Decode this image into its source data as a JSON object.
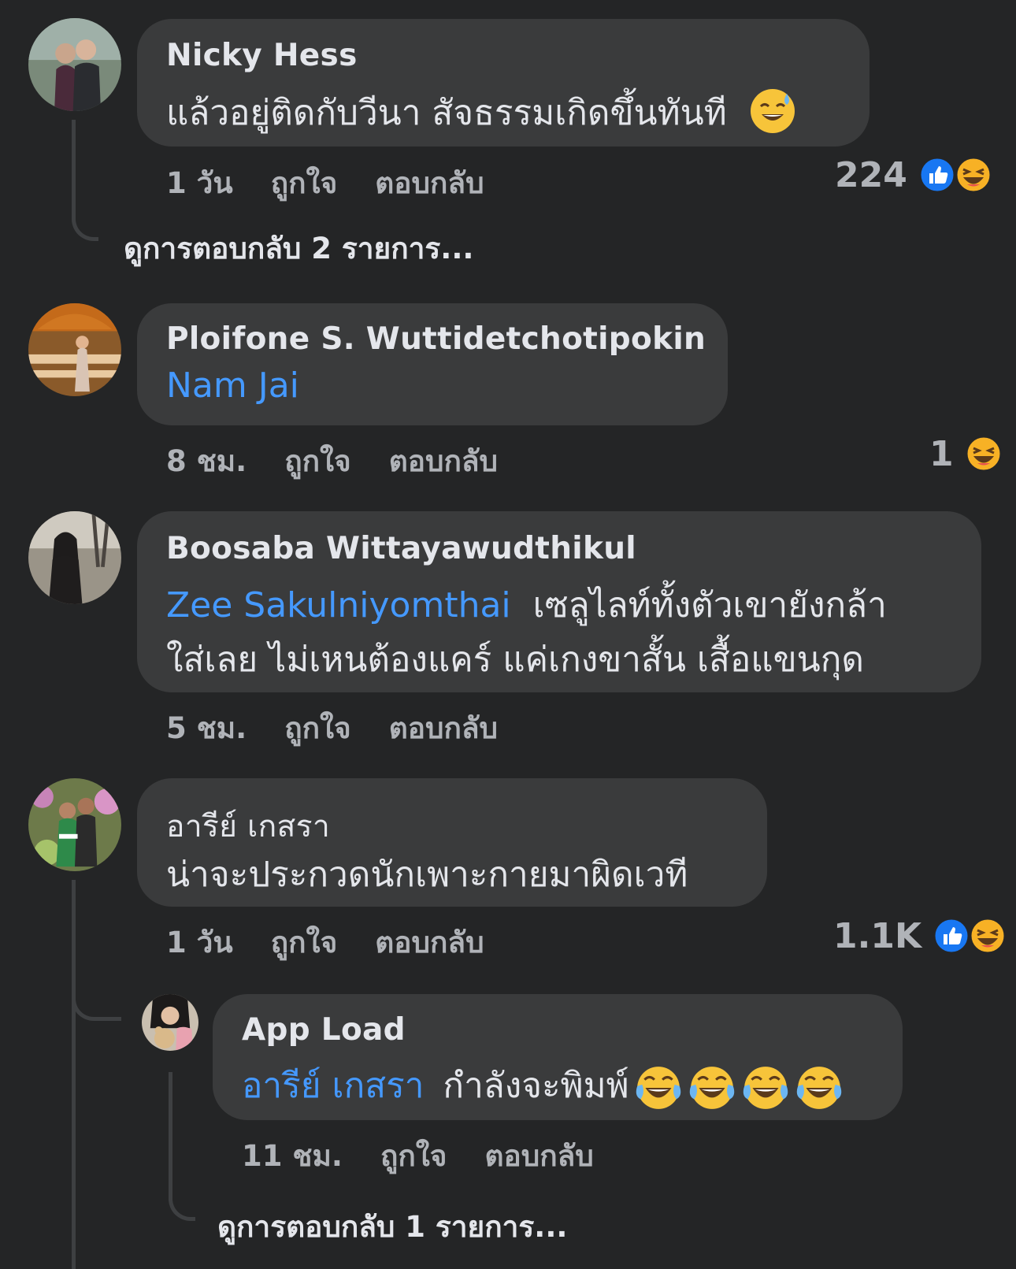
{
  "comments": [
    {
      "name": "Nicky Hess",
      "text": "แล้วอยู่ติดกับวีนา สัจธรรมเกิดขึ้นทันที",
      "text_emoji": "sweat-smile-emoji",
      "time": "1 วัน",
      "like": "ถูกใจ",
      "reply": "ตอบกลับ",
      "reaction_count": "224",
      "reactions": [
        "like-icon",
        "haha-icon"
      ],
      "view_replies": "ดูการตอบกลับ 2 รายการ..."
    },
    {
      "name": "Ploifone S. Wuttidetchotipokin",
      "mention": "Nam Jai",
      "time": "8 ชม.",
      "like": "ถูกใจ",
      "reply": "ตอบกลับ",
      "reaction_count": "1",
      "reactions": [
        "haha-icon"
      ]
    },
    {
      "name": "Boosaba Wittayawudthikul",
      "mention": "Zee Sakulniyomthai",
      "text_line1": "เซลูไลท์ทั้งตัวเขายังกล้า",
      "text_line2": "ใส่เลย ไม่เหนต้องแคร์ แค่เกงขาสั้น เสื้อแขนกุด",
      "time": "5 ชม.",
      "like": "ถูกใจ",
      "reply": "ตอบกลับ"
    },
    {
      "name": "อารีย์ เกสรา",
      "text": "น่าจะประกวดนักเพาะกายมาผิดเวที",
      "time": "1 วัน",
      "like": "ถูกใจ",
      "reply": "ตอบกลับ",
      "reaction_count": "1.1K",
      "reactions": [
        "like-icon",
        "haha-icon"
      ]
    }
  ],
  "reply": {
    "name": "App Load",
    "mention": "อารีย์ เกสรา",
    "text": "กำลังจะพิมพ์",
    "text_emojis": [
      "tears-of-joy-emoji",
      "tears-of-joy-emoji",
      "tears-of-joy-emoji",
      "tears-of-joy-emoji"
    ],
    "time": "11 ชม.",
    "like": "ถูกใจ",
    "reply": "ตอบกลับ",
    "view_replies": "ดูการตอบกลับ 1 รายการ..."
  },
  "colors": {
    "background": "#242526",
    "bubble": "#3a3b3c",
    "mention": "#4599ff",
    "like_blue": "#1877f2",
    "haha_yellow": "#f7b125"
  }
}
